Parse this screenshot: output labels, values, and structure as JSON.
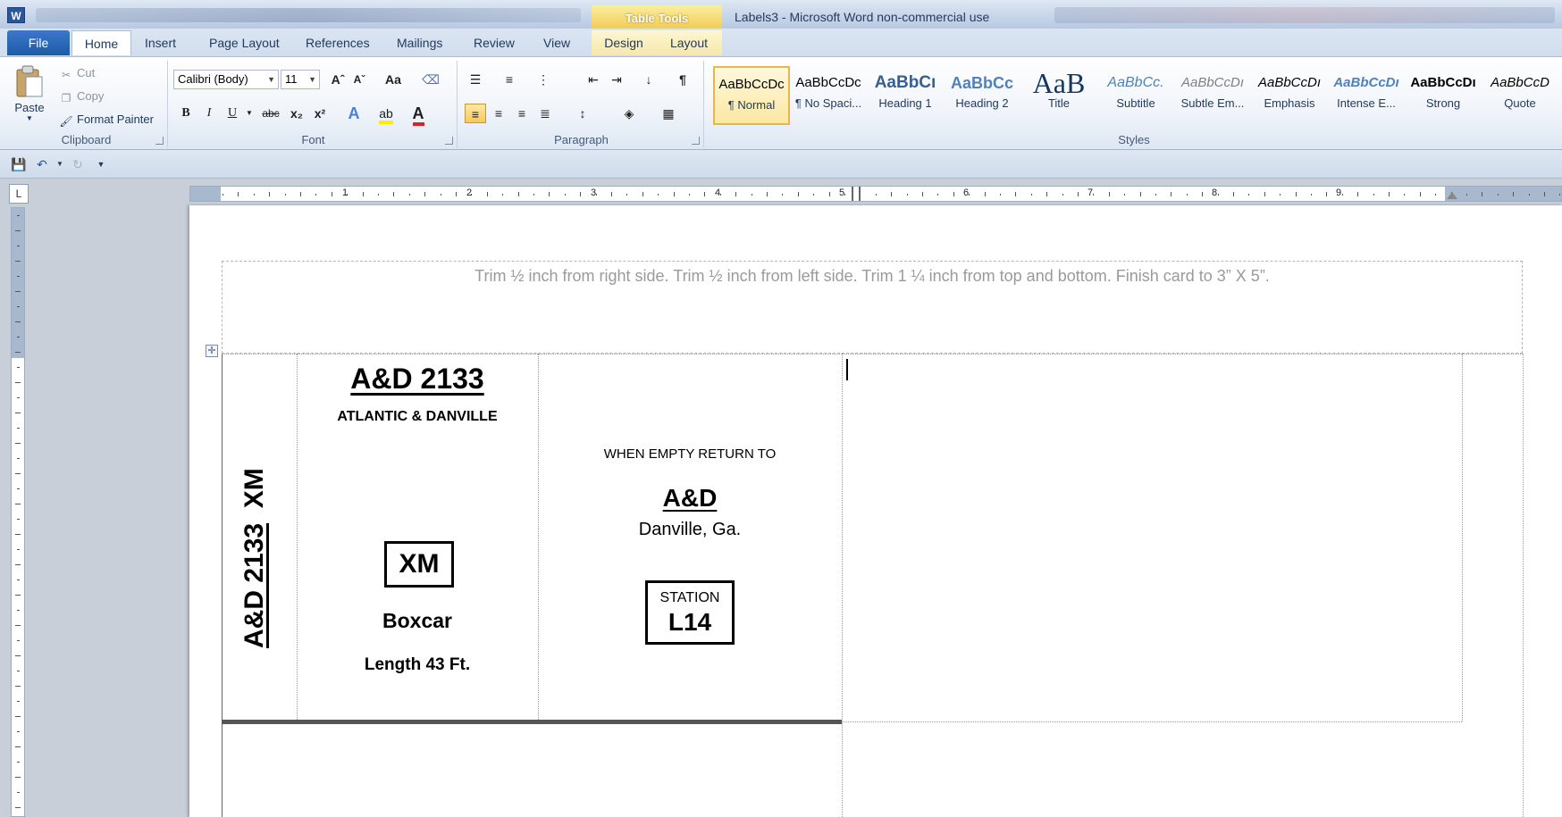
{
  "titlebar": {
    "app_icon": "W",
    "contextual_tab_group": "Table Tools",
    "document_title": "Labels3  -  Microsoft Word non-commercial use"
  },
  "tabs": [
    "File",
    "Home",
    "Insert",
    "Page Layout",
    "References",
    "Mailings",
    "Review",
    "View",
    "Design",
    "Layout"
  ],
  "clipboard": {
    "paste": "Paste",
    "cut": "Cut",
    "copy": "Copy",
    "format_painter": "Format Painter",
    "label": "Clipboard"
  },
  "font": {
    "name": "Calibri (Body)",
    "size": "11",
    "grow": "Aˆ",
    "shrink": "Aˇ",
    "change_case": "Aa",
    "bold": "B",
    "italic": "I",
    "underline": "U",
    "strikethrough": "abc",
    "subscript": "x₂",
    "superscript": "x²",
    "label": "Font"
  },
  "paragraph": {
    "label": "Paragraph",
    "pilcrow": "¶"
  },
  "styles": {
    "label": "Styles",
    "items": [
      {
        "sample": "AaBbCcDc",
        "name": "¶ Normal"
      },
      {
        "sample": "AaBbCcDc",
        "name": "¶ No Spaci..."
      },
      {
        "sample": "AaBbCı",
        "name": "Heading 1"
      },
      {
        "sample": "AaBbCc",
        "name": "Heading 2"
      },
      {
        "sample": "AaB",
        "name": "Title"
      },
      {
        "sample": "AaBbCc.",
        "name": "Subtitle"
      },
      {
        "sample": "AaBbCcDı",
        "name": "Subtle Em..."
      },
      {
        "sample": "AaBbCcDı",
        "name": "Emphasis"
      },
      {
        "sample": "AaBbCcDı",
        "name": "Intense E..."
      },
      {
        "sample": "AaBbCcDı",
        "name": "Strong"
      },
      {
        "sample": "AaBbCcD",
        "name": "Quote"
      }
    ]
  },
  "ruler": {
    "numbers": [
      "1",
      "2",
      "3",
      "4",
      "5",
      "6",
      "7",
      "8",
      "9"
    ],
    "corner": "L"
  },
  "document": {
    "instructions": "Trim ½ inch from right side.  Trim ½ inch from left side.  Trim 1 ¼ inch from top and bottom.  Finish card to 3” X 5”.",
    "side_text_number": "A&D 2133",
    "side_text_type": "XM",
    "car_number": "A&D 2133",
    "railroad_name": "ATLANTIC & DANVILLE",
    "type_code": "XM",
    "car_type": "Boxcar",
    "car_length": "Length 43 Ft.",
    "return_text": "WHEN EMPTY RETURN TO",
    "return_railroad": "A&D",
    "return_city": "Danville, Ga.",
    "station_label": "STATION",
    "station_code": "L14"
  },
  "colors": {
    "ribbon_accent": "#2b579a",
    "contextual_tab": "#f0c74a",
    "selected_style": "#e7b74b"
  }
}
